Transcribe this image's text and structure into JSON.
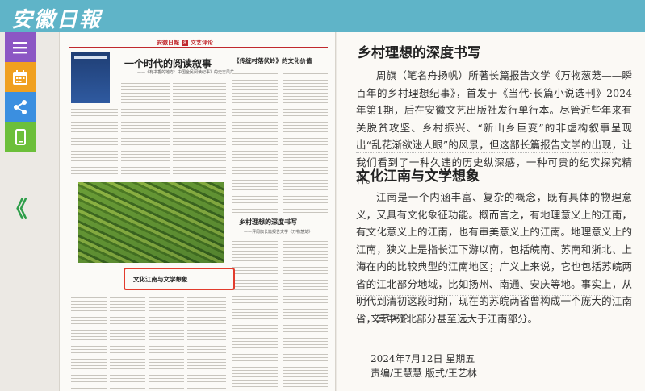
{
  "header": {
    "logo": "安徽日報"
  },
  "rail": {
    "icons": [
      "menu-icon",
      "calendar-icon",
      "share-icon",
      "mobile-icon"
    ],
    "prev": "《"
  },
  "newspaper": {
    "masthead_logo": "安徽日報",
    "page_number": "8",
    "section": "文艺评论",
    "headline_main": "一个时代的阅读叙事",
    "headline_main_sub": "——《有书香的地方：中国全民阅读纪事》的史志风范",
    "headline_second": "《传统村落伏岭》的文化价值",
    "headline_third": "乡村理想的深度书写",
    "headline_third_sub": "——评周旗长篇报告文学《万物葱茏》",
    "highlighted_headline": "文化江南与文学想象"
  },
  "article": {
    "section1_title": "乡村理想的深度书写",
    "section1_text": "周旗（笔名舟扬帆）所著长篇报告文学《万物葱茏——瞬百年的乡村理想纪事》，首发于《当代·长篇小说选刊》2024年第1期，后在安徽文艺出版社发行单行本。尽管近些年来有关脱贫攻坚、乡村振兴、“新山乡巨变”的非虚构叙事呈现出“乱花渐欲迷人眼”的风景，但这部长篇报告文学的出现，让我们看到了一种久违的历史纵深感，一种可贵的纪实探究精神。",
    "section2_title": "文化江南与文学想象",
    "section2_text": "江南是一个内涵丰富、复杂的概念，既有具体的物理意义，又具有文化象征功能。概而言之，有地理意义上的江南，有文化意义上的江南，也有审美意义上的江南。地理意义上的江南，狭义上是指长江下游以南，包括皖南、苏南和浙北、上海在内的比较典型的江南地区；广义上来说，它也包括苏皖两省的江北部分地域，比如扬州、南通、安庆等地。事实上，从明代到清初这段时期，现在的苏皖两省曾构成一个庞大的江南省，其中江北部分甚至远大于江南部分。",
    "column": "文艺评论",
    "date": "2024年7月12日 星期五",
    "editors": "责编/王慧慧 版式/王艺林"
  },
  "colors": {
    "topbar": "#5fb4c8",
    "menu": "#8c57c4",
    "calendar": "#f0a020",
    "share": "#3b8fe0",
    "mobile": "#6cbf3a",
    "highlight_border": "#e23b2c"
  }
}
